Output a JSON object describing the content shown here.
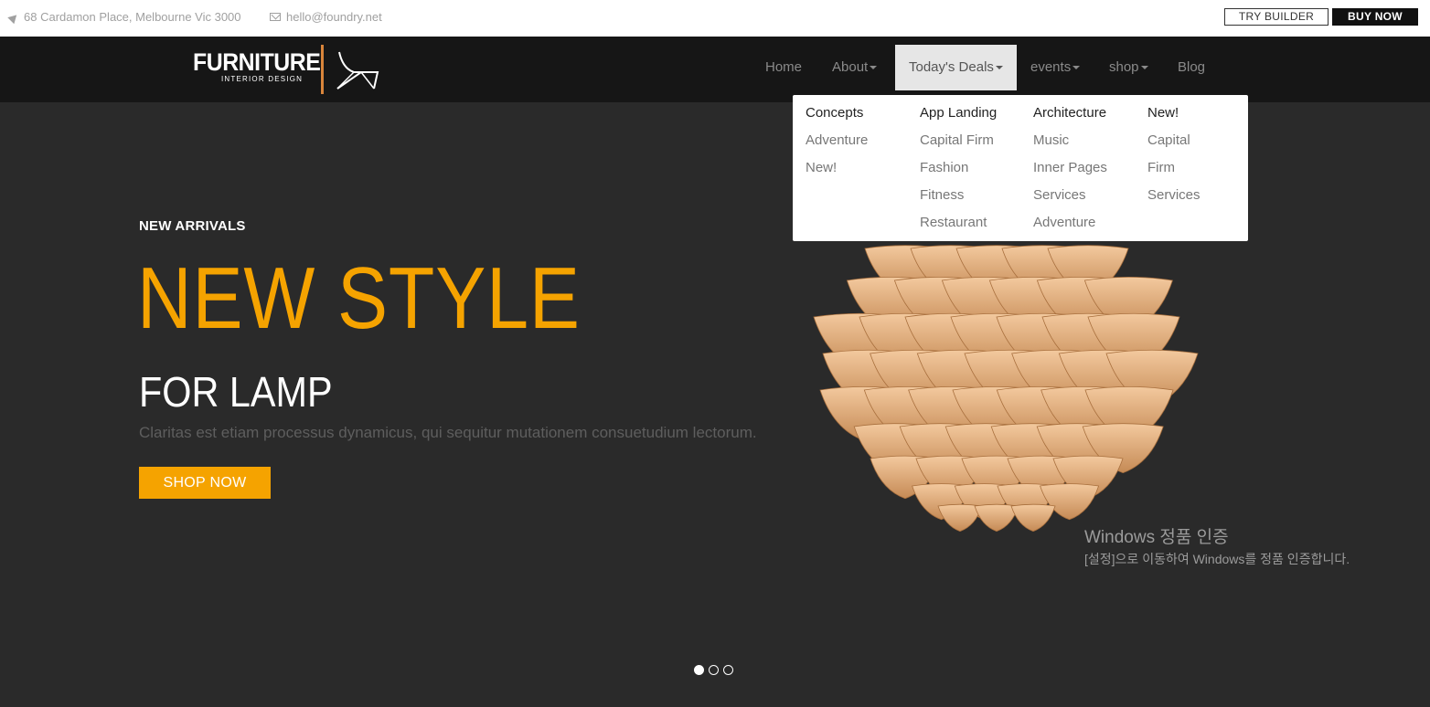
{
  "topbar": {
    "address": "68 Cardamon Place, Melbourne Vic 3000",
    "email": "hello@foundry.net",
    "try_builder": "TRY BUILDER",
    "buy_now": "BUY NOW"
  },
  "logo": {
    "title": "FURNITURE",
    "subtitle": "INTERIOR DESIGN",
    "accent_color": "#d9853b"
  },
  "nav": {
    "home": "Home",
    "about": "About",
    "deals": "Today's Deals",
    "events": "events",
    "shop": "shop",
    "blog": "Blog"
  },
  "megamenu": {
    "columns": [
      {
        "heading": "Concepts",
        "items": [
          "Adventure",
          "New!"
        ]
      },
      {
        "heading": "App Landing",
        "items": [
          "Capital Firm",
          "Fashion",
          "Fitness",
          "Restaurant"
        ]
      },
      {
        "heading": "Architecture",
        "items": [
          "Music",
          "Inner Pages",
          "Services",
          "Adventure"
        ]
      },
      {
        "heading": "New!",
        "items": [
          "Capital",
          "Firm",
          "Services"
        ]
      }
    ]
  },
  "hero": {
    "eyebrow": "NEW ARRIVALS",
    "headline": "NEW STYLE",
    "subhead": "FOR LAMP",
    "description": "Claritas est etiam processus dynamicus, qui sequitur mutationem consuetudium lectorum.",
    "cta": "SHOP NOW",
    "accent_color": "#f5a300",
    "slides_total": 3,
    "slide_active": 1
  },
  "watermark": {
    "line1": "Windows 정품 인증",
    "line2": "[설정]으로 이동하여 Windows를 정품 인증합니다."
  }
}
